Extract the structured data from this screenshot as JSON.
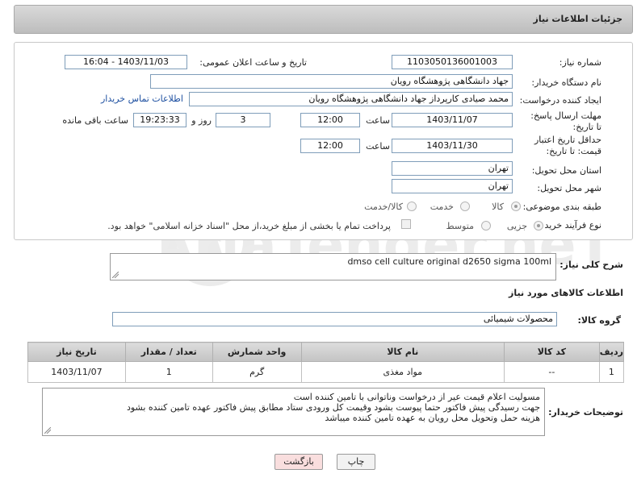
{
  "header": {
    "title": "جزئیات اطلاعات نیاز"
  },
  "form": {
    "need_number_label": "شماره نیاز:",
    "need_number": "1103050136001003",
    "announce_label": "تاریخ و ساعت اعلان عمومی:",
    "announce_value": "1403/11/03 - 16:04",
    "buyer_org_label": "نام دستگاه خریدار:",
    "buyer_org": "جهاد دانشگاهی پژوهشگاه رویان",
    "creator_label": "ایجاد کننده درخواست:",
    "creator": "محمد صیادی کارپرداز جهاد دانشگاهی پژوهشگاه رویان",
    "contact_link": "اطلاعات تماس خریدار",
    "reply_deadline_label": "مهلت ارسال پاسخ: تا تاریخ:",
    "reply_date": "1403/11/07",
    "time_label": "ساعت",
    "reply_time": "12:00",
    "days_value": "3",
    "days_label": "روز و",
    "remaining_time": "19:23:33",
    "remaining_label": "ساعت باقی مانده",
    "validity_label": "حداقل تاریخ اعتبار قیمت: تا تاریخ:",
    "validity_date": "1403/11/30",
    "validity_time": "12:00",
    "province_label": "استان محل تحویل:",
    "province": "تهران",
    "city_label": "شهر محل تحویل:",
    "city": "تهران",
    "category_label": "طبقه بندی موضوعی:",
    "category_options": [
      "کالا",
      "خدمت",
      "کالا/خدمت"
    ],
    "category_selected": "کالا",
    "process_label": "نوع فرآیند خرید :",
    "process_options": [
      "جزیی",
      "متوسط"
    ],
    "process_selected": "جزیی",
    "payment_note": "پرداخت تمام یا بخشی از مبلغ خرید،از محل \"اسناد خزانه اسلامی\" خواهد بود."
  },
  "summary": {
    "label": "شرح کلی نیاز:",
    "text": "dmso cell culture original d2650 sigma 100ml"
  },
  "goods_info": {
    "title": "اطلاعات کالاهای مورد نیاز",
    "group_label": "گروه کالا:",
    "group_value": "محصولات شیمیائی"
  },
  "table": {
    "headers": [
      "ردیف",
      "کد کالا",
      "نام کالا",
      "واحد شمارش",
      "تعداد / مقدار",
      "تاریخ نیاز"
    ],
    "rows": [
      [
        "1",
        "--",
        "مواد مغذی",
        "گرم",
        "1",
        "1403/11/07"
      ]
    ]
  },
  "buyer_notes": {
    "label": "توضیحات خریدار:",
    "lines": [
      "مسولیت اعلام قیمت  عیر از درخواست وناتوانی با تامین کننده است",
      "جهت رسیدگی پیش فاکتور حتما پیوست بشود وقیمت کل ورودی ستاد مطابق پیش فاکتور عهده تامین کننده بشود",
      "هزینه حمل وتحویل محل رویان به عهده تامین کننده میباشد"
    ]
  },
  "buttons": {
    "print": "چاپ",
    "back": "بازگشت"
  },
  "watermark": {
    "text": "AriaTender.neT"
  },
  "colors": {
    "link": "#1d4fa0",
    "back_button_bg": "#f9dede",
    "header_bg": "#cfcfcf"
  }
}
